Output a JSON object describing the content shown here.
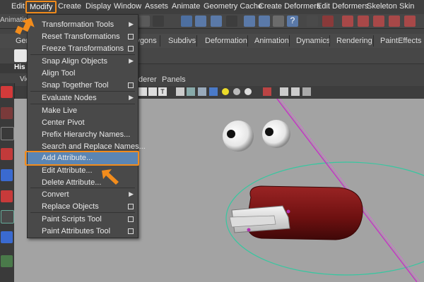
{
  "menubar": {
    "items": [
      "Edit",
      "Modify",
      "Create",
      "Display",
      "Window",
      "Assets",
      "Animate",
      "Geometry Cache",
      "Create Deformers",
      "Edit Deformers",
      "Skeleton",
      "Skin"
    ],
    "active": "Modify"
  },
  "left_stub": {
    "animation_label": "Animation",
    "ge_label": "Gen",
    "his_label": "His",
    "vie_label": "Vie"
  },
  "shelf_tabs": [
    "lygons",
    "Subdivs",
    "Deformation",
    "Animation",
    "Dynamics",
    "Rendering",
    "PaintEffects"
  ],
  "panel_menu": {
    "renderer": "derer",
    "panels": "Panels"
  },
  "dropdown": {
    "items": [
      {
        "label": "Transformation Tools",
        "suffix": "arrow"
      },
      {
        "label": "Reset Transformations",
        "suffix": "box"
      },
      {
        "label": "Freeze Transformations",
        "suffix": "box"
      },
      {
        "label": "Snap Align Objects",
        "suffix": "arrow"
      },
      {
        "label": "Align Tool",
        "suffix": ""
      },
      {
        "label": "Snap Together Tool",
        "suffix": "box"
      },
      {
        "label": "Evaluate Nodes",
        "suffix": "arrow"
      },
      {
        "label": "Make Live",
        "suffix": ""
      },
      {
        "label": "Center Pivot",
        "suffix": ""
      },
      {
        "label": "Prefix Hierarchy Names...",
        "suffix": ""
      },
      {
        "label": "Search and Replace Names...",
        "suffix": ""
      },
      {
        "label": "Add Attribute...",
        "suffix": "",
        "highlighted": true
      },
      {
        "label": "Edit Attribute...",
        "suffix": ""
      },
      {
        "label": "Delete Attribute...",
        "suffix": ""
      },
      {
        "label": "Convert",
        "suffix": "arrow"
      },
      {
        "label": "Replace Objects",
        "suffix": "box"
      },
      {
        "label": "Paint Scripts Tool",
        "suffix": "box"
      },
      {
        "label": "Paint Attributes Tool",
        "suffix": "box"
      }
    ]
  },
  "colors": {
    "accent_orange": "#f28c1c",
    "highlight_blue": "#5b85b3",
    "viewport_bg": "#a3a3a3",
    "mouth_red": "#7a1414"
  }
}
